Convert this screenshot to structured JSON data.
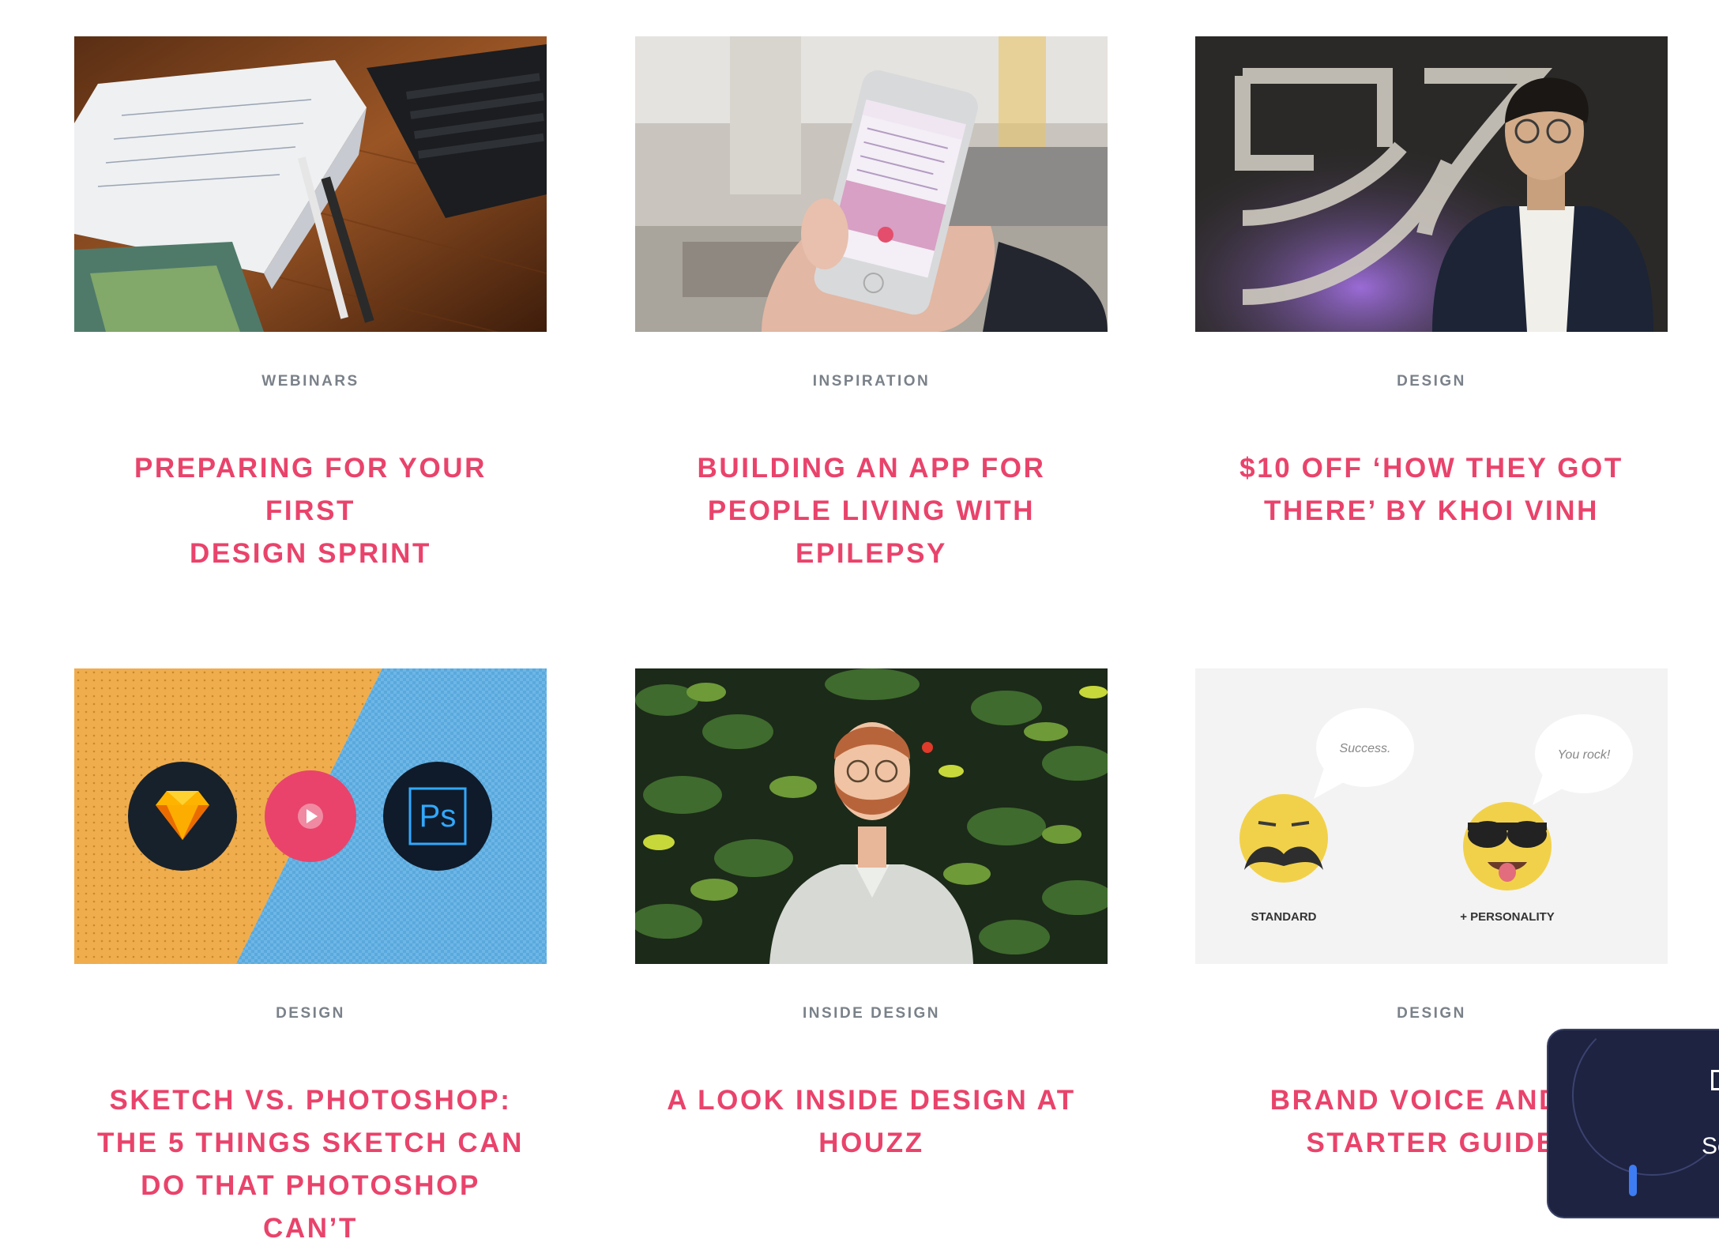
{
  "cards": [
    {
      "category": "WEBINARS",
      "title_lines": [
        "PREPARING FOR YOUR FIRST",
        "DESIGN SPRINT"
      ],
      "image": "notebook-pens-laptop-photo"
    },
    {
      "category": "INSPIRATION",
      "title_lines": [
        "BUILDING AN APP FOR",
        "PEOPLE LIVING WITH",
        "EPILEPSY"
      ],
      "image": "hand-holding-phone-photo"
    },
    {
      "category": "DESIGN",
      "title_lines": [
        "$10 OFF ‘HOW THEY GOT",
        "THERE’ BY KHOI VINH"
      ],
      "image": "speaker-on-stage-photo"
    },
    {
      "category": "DESIGN",
      "title_lines": [
        "SKETCH VS. PHOTOSHOP:",
        "THE 5 THINGS SKETCH CAN",
        "DO THAT PHOTOSHOP CAN’T"
      ],
      "image": "sketch-vs-photoshop-video-thumbnail",
      "ps_label": "Ps"
    },
    {
      "category": "INSIDE DESIGN",
      "title_lines": [
        "A LOOK INSIDE DESIGN AT",
        "HOUZZ"
      ],
      "image": "man-in-front-of-plant-wall-photo"
    },
    {
      "category": "DESIGN",
      "title_lines": [
        "BRAND VOICE AND U",
        "STARTER GUIDE"
      ],
      "image": "emoji-personality-illustration",
      "bubble_left": "Success.",
      "bubble_right": "You rock!",
      "label_left": "STANDARD",
      "label_right": "+ PERSONALITY"
    }
  ],
  "popup": {
    "text": "Se",
    "icon": "square-icon"
  },
  "colors": {
    "title": "#e9436b",
    "category": "#7a8189",
    "popup_bg": "#1d2340",
    "popup_accent": "#3d7cf2"
  }
}
